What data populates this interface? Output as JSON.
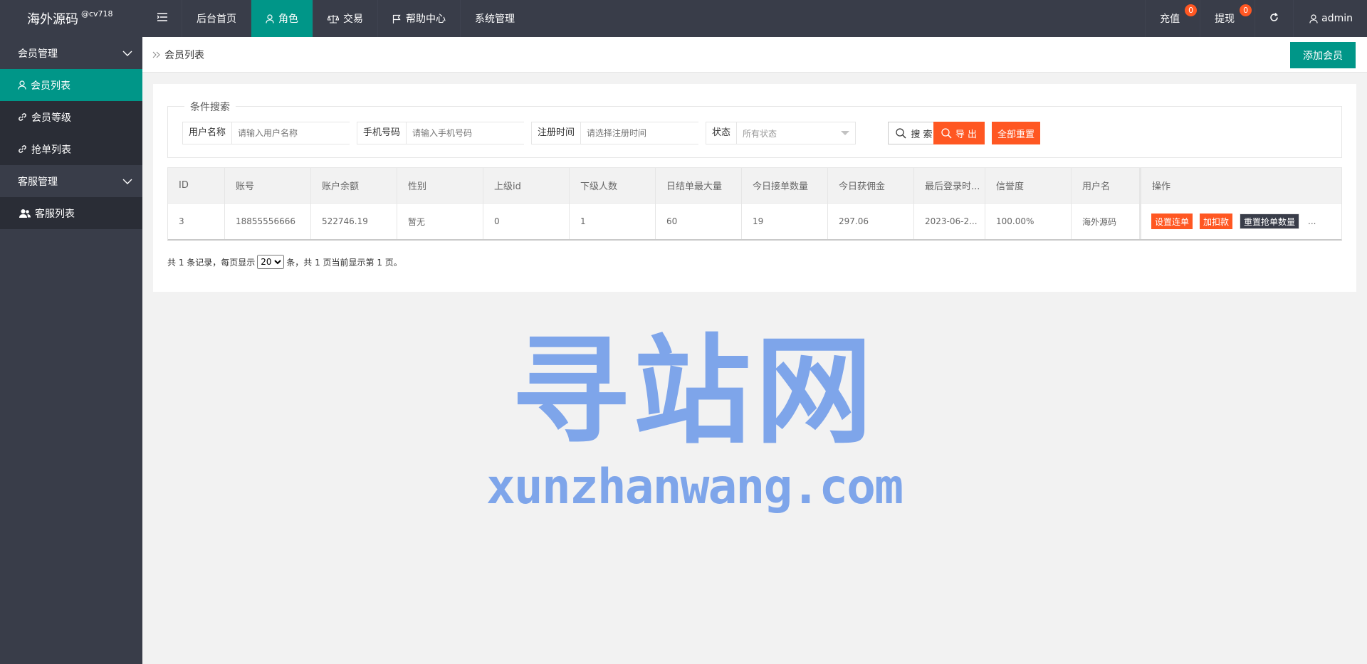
{
  "brand": {
    "name": "海外源码",
    "sup": "@cv718"
  },
  "topnav": {
    "items": [
      {
        "label": "后台首页",
        "icon": "none"
      },
      {
        "label": "角色",
        "icon": "user-icon",
        "active": true
      },
      {
        "label": "交易",
        "icon": "scale-icon"
      },
      {
        "label": "帮助中心",
        "icon": "flag-icon"
      },
      {
        "label": "系统管理",
        "icon": "none"
      }
    ],
    "right": {
      "recharge": {
        "label": "充值",
        "badge": "0"
      },
      "withdraw": {
        "label": "提现",
        "badge": "0"
      },
      "user": "admin"
    }
  },
  "sidebar": {
    "groups": [
      {
        "label": "会员管理",
        "items": [
          {
            "label": "会员列表",
            "icon": "user-icon",
            "active": true
          },
          {
            "label": "会员等级",
            "icon": "link-icon"
          },
          {
            "label": "抢单列表",
            "icon": "link-icon"
          }
        ]
      },
      {
        "label": "客服管理",
        "items": [
          {
            "label": "客服列表",
            "icon": "users-icon"
          }
        ]
      }
    ]
  },
  "breadcrumb": {
    "label": "会员列表"
  },
  "toolbar": {
    "add_label": "添加会员"
  },
  "search": {
    "legend": "条件搜索",
    "username": {
      "label": "用户名称",
      "placeholder": "请输入用户名称"
    },
    "phone": {
      "label": "手机号码",
      "placeholder": "请输入手机号码"
    },
    "regtime": {
      "label": "注册时间",
      "placeholder": "请选择注册时间"
    },
    "status": {
      "label": "状态",
      "value": "所有状态"
    },
    "search_btn": "搜 索",
    "export_btn": "导 出",
    "reset_btn": "全部重置"
  },
  "table": {
    "headers": [
      "ID",
      "账号",
      "账户余额",
      "性别",
      "上级id",
      "下级人数",
      "日结单最大量",
      "今日接单数量",
      "今日获佣金",
      "最后登录时...",
      "信誉度",
      "用户名",
      "操作"
    ],
    "rows": [
      {
        "cells": [
          "3",
          "18855556666",
          "522746.19",
          "暂无",
          "0",
          "1",
          "60",
          "19",
          "297.06",
          "2023-06-2...",
          "100.00%",
          "海外源码"
        ],
        "actions": [
          "设置连单",
          "加扣款",
          "重置抢单数量"
        ],
        "more": "..."
      }
    ]
  },
  "pager": {
    "before": "共 1 条记录，每页显示",
    "page_size": "20",
    "after": "条，共 1 页当前显示第 1 页。"
  },
  "watermark": {
    "cn": "寻站网",
    "en": "xunzhanwang.com"
  },
  "colors": {
    "header": "#393d49",
    "accent": "#009688",
    "orange": "#ff5722"
  }
}
